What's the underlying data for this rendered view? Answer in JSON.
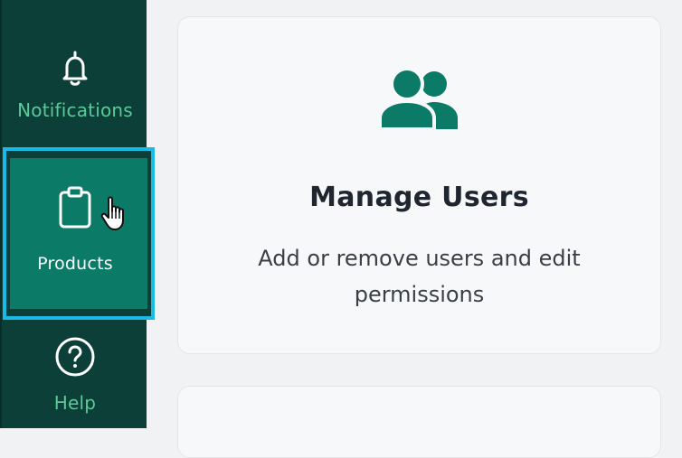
{
  "sidebar": {
    "items": [
      {
        "label": "Notifications",
        "icon": "bell-icon"
      },
      {
        "label": "Products",
        "icon": "clipboard-icon",
        "active": true
      },
      {
        "label": "Help",
        "icon": "help-circle-icon"
      }
    ]
  },
  "main": {
    "cards": [
      {
        "icon": "users-icon",
        "title": "Manage Users",
        "description": "Add or remove users and edit permissions"
      }
    ]
  },
  "colors": {
    "sidebar_bg": "#0b3f37",
    "active_bg": "#0b7a67",
    "focus_ring": "#1ab9e6",
    "accent_green": "#5cc99a",
    "icon_teal": "#0b7a67"
  }
}
